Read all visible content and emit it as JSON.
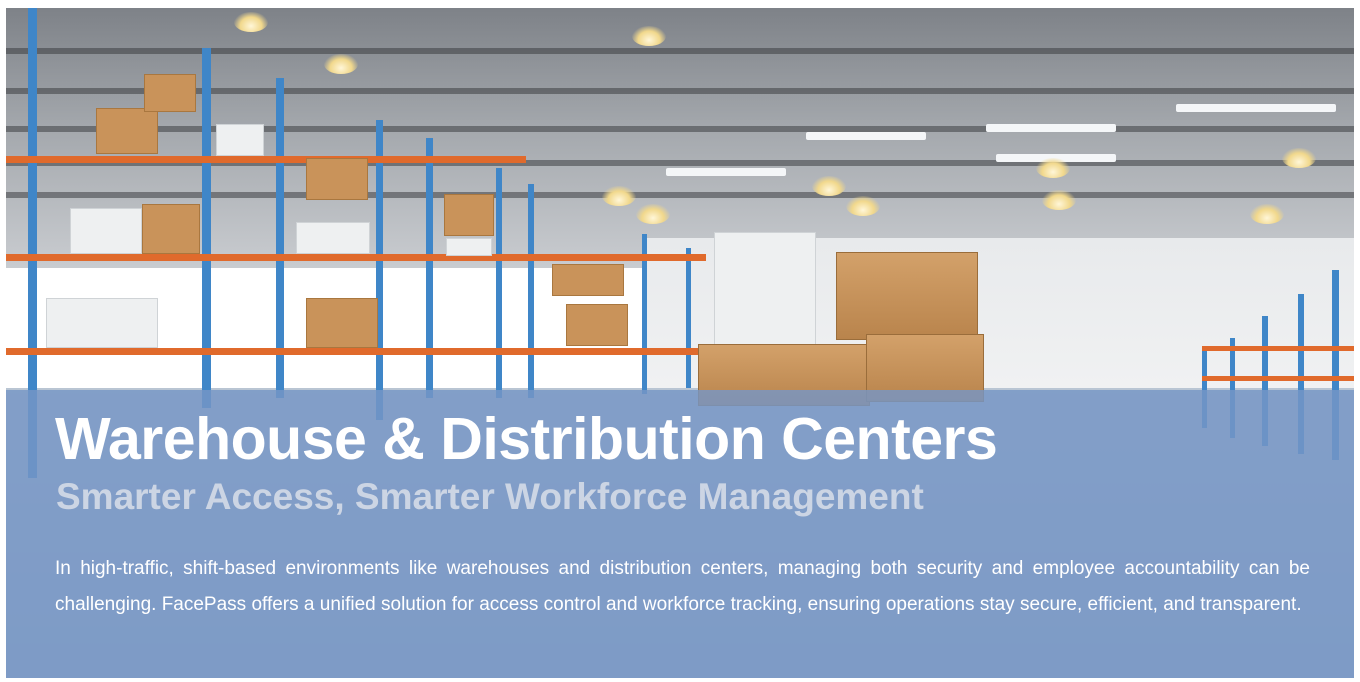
{
  "hero": {
    "background_image": "warehouse-interior-photo",
    "overlay_color": "#7696C6",
    "title": "Warehouse & Distribution Centers",
    "subtitle": "Smarter Access, Smarter Workforce Management",
    "description": "In high-traffic, shift-based environments like warehouses and distribution centers, managing both security and employee accountability can be challenging. FacePass offers a unified solution for access control and workforce tracking, ensuring operations stay secure, efficient, and transparent."
  }
}
